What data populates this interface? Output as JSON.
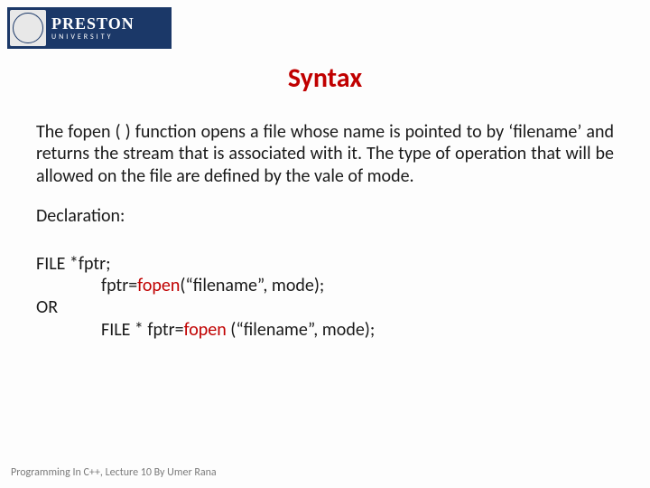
{
  "logo": {
    "line1": "PRESTON",
    "line2": "UNIVERSITY"
  },
  "title": "Syntax",
  "paragraph": "The fopen ( ) function opens a file whose name is pointed to by ‘filename’ and returns the stream that is associated with it. The type of operation that will be allowed on the file are defined by the vale of mode.",
  "declaration_label": "Declaration:",
  "code": {
    "l1": "FILE *fptr;",
    "l2a": "fptr=",
    "l2b": "fopen",
    "l2c": "(“filename”, mode);",
    "l3": "OR",
    "l4a": "FILE * fptr=",
    "l4b": "fopen ",
    "l4c": "(“filename”, mode);"
  },
  "footer": "Programming In C++, Lecture 10 By Umer Rana"
}
